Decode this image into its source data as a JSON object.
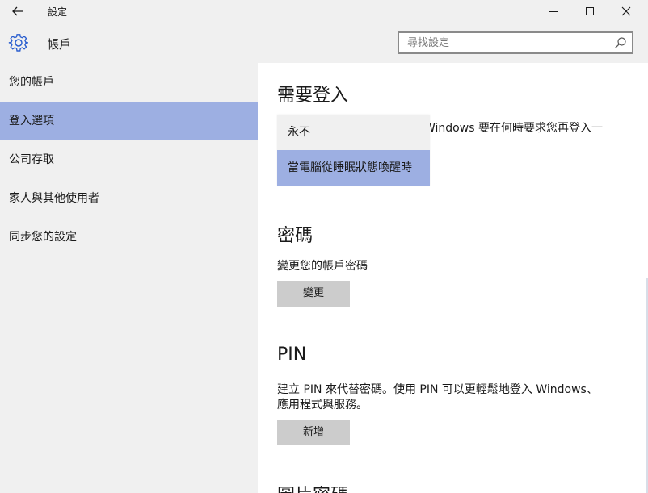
{
  "window": {
    "title": "設定"
  },
  "header": {
    "title": "帳戶",
    "search_placeholder": "尋找設定"
  },
  "sidebar": {
    "items": [
      {
        "label": "您的帳戶"
      },
      {
        "label": "登入選項",
        "selected": true
      },
      {
        "label": "公司存取"
      },
      {
        "label": "家人與其他使用者"
      },
      {
        "label": "同步您的設定"
      }
    ]
  },
  "main": {
    "require_signin": {
      "title": "需要登入",
      "description_visible": "Windows 要在何時要求您再登入一",
      "dropdown_options": [
        {
          "label": "永不"
        },
        {
          "label": "當電腦從睡眠狀態喚醒時",
          "selected": true
        }
      ]
    },
    "password": {
      "title": "密碼",
      "description": "變更您的帳戶密碼",
      "button_label": "變更"
    },
    "pin": {
      "title": "PIN",
      "description_line1": "建立 PIN 來代替密碼。使用 PIN 可以更輕鬆地登入 Windows、",
      "description_line2": "應用程式與服務。",
      "button_label": "新增"
    },
    "picture_password": {
      "title": "圖片密碼"
    }
  },
  "colors": {
    "selected": "#9dafe2",
    "chrome": "#f0f0f0",
    "button": "#cccccc",
    "accent": "#2a5ecf"
  }
}
